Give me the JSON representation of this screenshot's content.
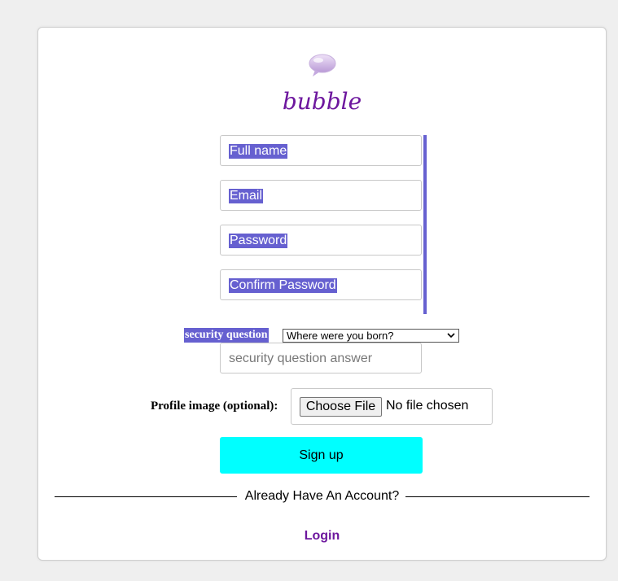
{
  "brand": {
    "name": "bubble",
    "icon": "speech-bubble-icon",
    "color": "#6d179e"
  },
  "form": {
    "full_name_placeholder": "Full name",
    "email_placeholder": "Email",
    "password_placeholder": "Password",
    "confirm_password_placeholder": "Confirm Password",
    "security_question_label": "security question",
    "security_question_selected": "Where were you born?",
    "security_answer_placeholder": "security question answer",
    "profile_image_label": "Profile image (optional):",
    "file_button_label": "Choose File",
    "file_status": "No file chosen",
    "signup_label": "Sign up"
  },
  "footer": {
    "divider_text": "Already Have An Account?",
    "login_label": "Login"
  },
  "colors": {
    "selection": "#6660d0",
    "signup_button": "#00ffff",
    "accent": "#6d179e"
  }
}
